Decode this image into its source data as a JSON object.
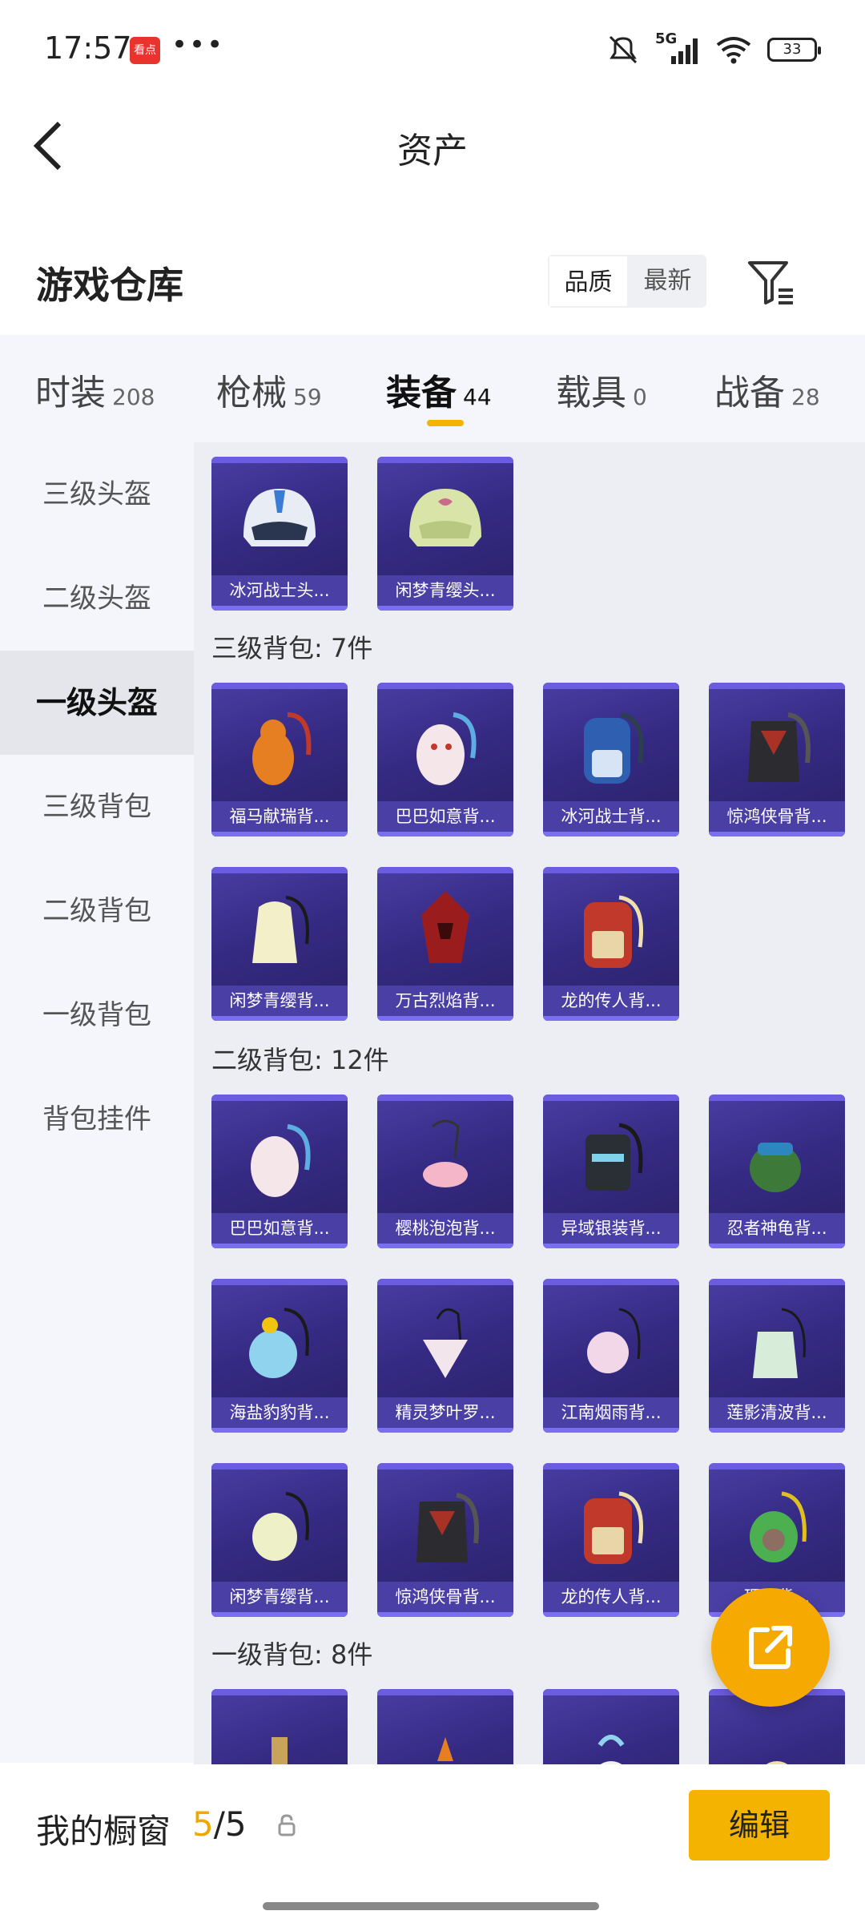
{
  "status_bar": {
    "time": "17:57",
    "app_badge": "看点",
    "more": "•••",
    "network": "5G",
    "battery": "33"
  },
  "nav": {
    "title": "资产"
  },
  "repo": {
    "title": "游戏仓库",
    "sort_options": [
      "品质",
      "最新"
    ],
    "active_sort": "品质"
  },
  "tabs": [
    {
      "label": "时装",
      "count": "208"
    },
    {
      "label": "枪械",
      "count": "59"
    },
    {
      "label": "装备",
      "count": "44"
    },
    {
      "label": "载具",
      "count": "0"
    },
    {
      "label": "战备",
      "count": "28"
    }
  ],
  "active_tab": "装备",
  "sidebar": {
    "items": [
      "三级头盔",
      "二级头盔",
      "一级头盔",
      "三级背包",
      "二级背包",
      "一级背包",
      "背包挂件"
    ],
    "active": "一级头盔"
  },
  "sections": {
    "helmets_lvl1": [
      "冰河战士头...",
      "闲梦青缨头..."
    ],
    "backpack_lvl3": {
      "title": "三级背包: 7件",
      "items": [
        "福马献瑞背...",
        "巴巴如意背...",
        "冰河战士背...",
        "惊鸿侠骨背...",
        "闲梦青缨背...",
        "万古烈焰背...",
        "龙的传人背..."
      ]
    },
    "backpack_lvl2": {
      "title": "二级背包: 12件",
      "items": [
        "巴巴如意背...",
        "樱桃泡泡背...",
        "异域银装背...",
        "忍者神龟背...",
        "海盐豹豹背...",
        "精灵梦叶罗...",
        "江南烟雨背...",
        "莲影清波背...",
        "闲梦青缨背...",
        "惊鸿侠骨背...",
        "龙的传人背...",
        "理...背..."
      ]
    },
    "backpack_lvl1": {
      "title": "一级背包: 8件"
    }
  },
  "bottom": {
    "label": "我的橱窗",
    "used": "5",
    "total": "/5",
    "edit_label": "编辑"
  },
  "colors": {
    "accent": "#f5b301",
    "card_bg": "#352a83",
    "fab": "#f6a900"
  }
}
